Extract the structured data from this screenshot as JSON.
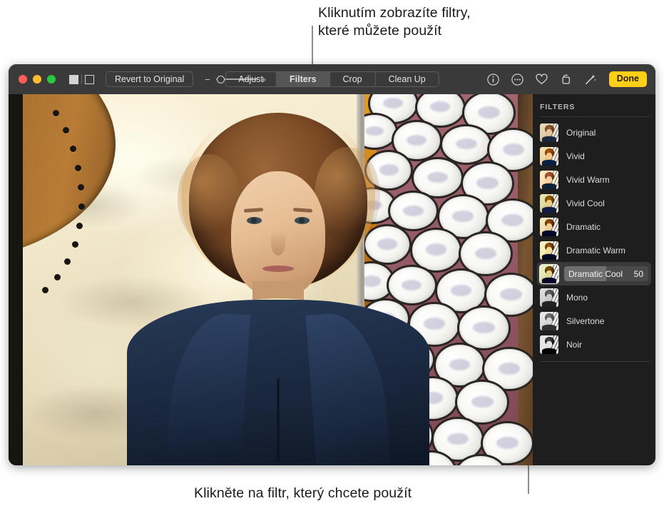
{
  "callouts": {
    "top": "Kliknutím zobrazíte filtry,\nkteré můžete použít",
    "bottom": "Klikněte na filtr, který chcete použít"
  },
  "window": {
    "toolbar": {
      "traffic_lights": [
        "close-red",
        "minimize-yellow",
        "zoom-green"
      ],
      "view_toggle": {
        "filled_label": "single-view",
        "outline_label": "split-view"
      },
      "revert_label": "Revert to Original",
      "zoom_slider": {
        "minus": "−",
        "plus": "+",
        "value": 8
      },
      "segments": [
        {
          "label": "Adjust",
          "active": false
        },
        {
          "label": "Filters",
          "active": true
        },
        {
          "label": "Crop",
          "active": false
        },
        {
          "label": "Clean Up",
          "active": false
        }
      ],
      "icons": [
        {
          "name": "info-icon",
          "glyph": "i"
        },
        {
          "name": "more-options-icon",
          "glyph": "…"
        },
        {
          "name": "favorite-heart-icon",
          "glyph": "♡"
        },
        {
          "name": "rotate-icon",
          "glyph": "⟲"
        },
        {
          "name": "magic-wand-icon",
          "glyph": "✨"
        }
      ],
      "done_label": "Done"
    },
    "sidebar": {
      "title": "FILTERS",
      "selected_filter": "Dramatic Cool",
      "selected_value": "50",
      "selected_percent": 50,
      "filters": [
        {
          "label": "Original",
          "variant": "v-orig",
          "selected": false
        },
        {
          "label": "Vivid",
          "variant": "v-vivid",
          "selected": false
        },
        {
          "label": "Vivid Warm",
          "variant": "v-vividwarm",
          "selected": false
        },
        {
          "label": "Vivid Cool",
          "variant": "v-vividcool",
          "selected": false
        },
        {
          "label": "Dramatic",
          "variant": "v-dramatic",
          "selected": false
        },
        {
          "label": "Dramatic Warm",
          "variant": "v-dramwarm",
          "selected": false
        },
        {
          "label": "Dramatic Cool",
          "variant": "v-dramcool",
          "selected": true,
          "value": "50"
        },
        {
          "label": "Mono",
          "variant": "v-mono",
          "selected": false
        },
        {
          "label": "Silvertone",
          "variant": "v-silver",
          "selected": false
        },
        {
          "label": "Noir",
          "variant": "v-noir",
          "selected": false
        }
      ]
    }
  },
  "colors": {
    "accent_done": "#fdd017",
    "toolbar_bg": "#3a3a3a",
    "window_bg": "#1e1e1e",
    "selected_row": "#3a3a3a",
    "slider_fill": "#6e6e6e",
    "callout_text": "#1b1b1b",
    "leader_line": "#8c8c8c"
  }
}
